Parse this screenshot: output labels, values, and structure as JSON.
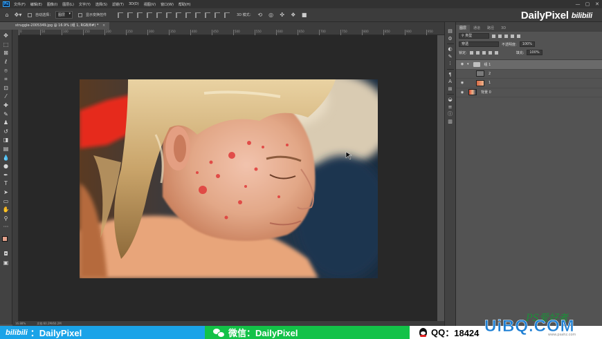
{
  "menubar": {
    "app_logo": "Ps",
    "items": [
      "文件(F)",
      "编辑(E)",
      "图像(I)",
      "图层(L)",
      "文字(Y)",
      "选择(S)",
      "滤镜(T)",
      "3D(D)",
      "视图(V)",
      "窗口(W)",
      "帮助(H)"
    ],
    "window_controls": [
      "—",
      "▢",
      "✕"
    ]
  },
  "optionsbar": {
    "auto_select_label": "自动选择：",
    "auto_select_value": "图层",
    "show_transform_label": "显示变换控件",
    "mode_3d_label": "3D 模式："
  },
  "brand": {
    "name": "DailyPixel",
    "site": "bilibili"
  },
  "document": {
    "tab_title": "struggle-2005349.jpg @ 16.9% (组 1, RGB/8#) *",
    "close": "×",
    "ruler_ticks": [
      "0",
      "50",
      "100",
      "150",
      "200",
      "250",
      "300",
      "350",
      "400",
      "450",
      "500",
      "550",
      "600",
      "650",
      "700",
      "750",
      "800",
      "850",
      "900",
      "950"
    ]
  },
  "statusbar": {
    "zoom": "16.88%",
    "doc_size": "文档:60.2M/60.2M"
  },
  "tools": [
    {
      "name": "move-tool-icon",
      "glyph": "✥"
    },
    {
      "name": "marquee-tool-icon",
      "glyph": "⬚"
    },
    {
      "name": "artboard-tool-icon",
      "glyph": "⊠"
    },
    {
      "name": "lasso-tool-icon",
      "glyph": "ℓ"
    },
    {
      "name": "quick-select-tool-icon",
      "glyph": "⌾"
    },
    {
      "name": "crop-tool-icon",
      "glyph": "⌗"
    },
    {
      "name": "frame-tool-icon",
      "glyph": "⊡"
    },
    {
      "name": "eyedropper-tool-icon",
      "glyph": "⁄"
    },
    {
      "name": "healing-brush-tool-icon",
      "glyph": "✚"
    },
    {
      "name": "brush-tool-icon",
      "glyph": "✎"
    },
    {
      "name": "clone-stamp-tool-icon",
      "glyph": "♟"
    },
    {
      "name": "history-brush-tool-icon",
      "glyph": "↺"
    },
    {
      "name": "eraser-tool-icon",
      "glyph": "◨"
    },
    {
      "name": "gradient-tool-icon",
      "glyph": "▤"
    },
    {
      "name": "blur-tool-icon",
      "glyph": "💧"
    },
    {
      "name": "dodge-tool-icon",
      "glyph": "●"
    },
    {
      "name": "pen-tool-icon",
      "glyph": "✒"
    },
    {
      "name": "type-tool-icon",
      "glyph": "T"
    },
    {
      "name": "path-select-tool-icon",
      "glyph": "➤"
    },
    {
      "name": "shape-tool-icon",
      "glyph": "▭"
    },
    {
      "name": "hand-tool-icon",
      "glyph": "✋"
    },
    {
      "name": "zoom-tool-icon",
      "glyph": "⚲"
    },
    {
      "name": "more-tools-icon",
      "glyph": "···"
    }
  ],
  "right_icons": [
    {
      "name": "history-panel-icon",
      "glyph": "▤"
    },
    {
      "name": "properties-panel-icon",
      "glyph": "⚙"
    },
    {
      "name": "adjustments-panel-icon",
      "glyph": "◐"
    },
    {
      "name": "styles-panel-icon",
      "glyph": "✎"
    },
    {
      "name": "brush-panel-icon",
      "glyph": "ⵗ"
    },
    {
      "name": "paragraph-panel-icon",
      "glyph": "¶"
    },
    {
      "name": "character-panel-icon",
      "glyph": "A"
    },
    {
      "name": "swatches-panel-icon",
      "glyph": "⊞"
    },
    {
      "name": "channels-panel-icon",
      "glyph": "◒"
    },
    {
      "name": "paths-panel-icon",
      "glyph": "≡"
    },
    {
      "name": "info-panel-icon",
      "glyph": "ⓘ"
    },
    {
      "name": "libraries-panel-icon",
      "glyph": "▥"
    }
  ],
  "layers_panel": {
    "tabs": [
      "图层",
      "通道",
      "路径",
      "3D"
    ],
    "active_tab": 0,
    "filter_label": "类型",
    "blend_mode": "穿透",
    "opacity_label": "不透明度:",
    "opacity_value": "100%",
    "lock_label": "锁定:",
    "fill_label": "填充:",
    "fill_value": "100%",
    "layers": [
      {
        "name": "组 1",
        "type": "group",
        "selected": true,
        "visible": true
      },
      {
        "name": "2",
        "type": "layer",
        "selected": false,
        "visible": false
      },
      {
        "name": "1",
        "type": "layer",
        "selected": false,
        "visible": true
      },
      {
        "name": "背景 0",
        "type": "layer",
        "selected": false,
        "visible": true
      }
    ]
  },
  "bottom_bar": {
    "bilibili_label": "bilibili",
    "bilibili_text": "：DailyPixel",
    "wechat_label": "微信",
    "wechat_text": "：DailyPixel",
    "qq_label": "QQ",
    "qq_text": "：18424",
    "colors": {
      "bilibili": "#1aa3e8",
      "wechat": "#13c248"
    }
  },
  "watermark": {
    "ps": "PS爱好者",
    "site": "UiBQ.COM",
    "sub": "www.psahz.com"
  }
}
